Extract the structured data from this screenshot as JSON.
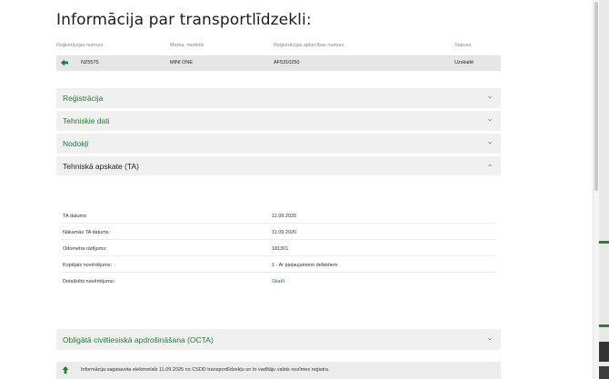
{
  "page": {
    "title": "Informācija par transportlīdzekli:"
  },
  "vehicle_table": {
    "headers": {
      "reg_number": "Reģistrācijas numurs",
      "make_model": "Marka, modelis",
      "cert_number": "Reģistrācijas apliecības numurs",
      "status": "Statuss"
    },
    "row": {
      "reg_number": "NZ5575",
      "make_model": "MINI ONE",
      "cert_number": "AF5310250",
      "status": "Uzskaitē"
    }
  },
  "accordion": {
    "registration": "Reģistrācija",
    "technical": "Tehniskie dati",
    "taxes": "Nodokļi",
    "inspection": "Tehniskā apskate (TA)",
    "insurance": "Obligātā civiltiesiskā apdrošināšana (OCTA)"
  },
  "inspection": {
    "rows": [
      {
        "key": "TA datums:",
        "value": "11.09.2025"
      },
      {
        "key": "Nākamās TA datums:",
        "value": "11.09.2026"
      },
      {
        "key": "Odometra rādījums:",
        "value": "181301"
      },
      {
        "key": "Kopējais novērtējums:",
        "value": "1 - Ar pieļaujamiem defektiem"
      },
      {
        "key": "Detalizēts novērtējums:",
        "value": "Skatīt"
      }
    ]
  },
  "footer": {
    "info_text": "Informācija sagatavota elektroniski 11.09.2025 no CSDD transportlīdzekļu un to vadītāju valsts nozīmes reģistra."
  },
  "colors": {
    "accent": "#1e7d32",
    "panel": "#f0f0f0"
  },
  "icons": {
    "back": "arrow-left-icon",
    "up": "arrow-up-icon",
    "chevron": "chevron-icon"
  }
}
